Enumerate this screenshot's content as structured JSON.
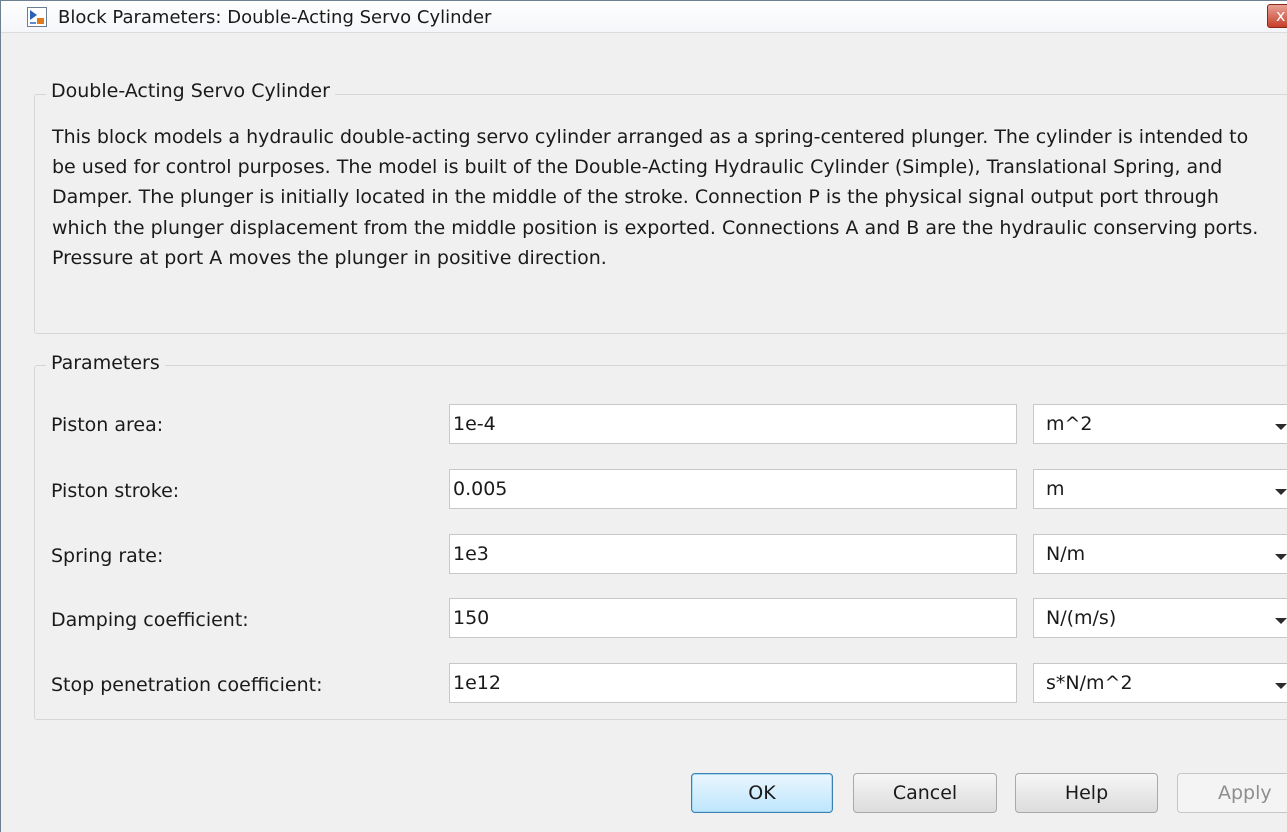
{
  "window": {
    "title": "Block Parameters: Double-Acting Servo Cylinder",
    "close_glyph": "x"
  },
  "description_group": {
    "title": "Double-Acting Servo Cylinder",
    "text": "This block models a hydraulic double-acting servo cylinder arranged as a spring-centered plunger. The cylinder is intended to be used for control purposes. The model is built of the Double-Acting Hydraulic Cylinder (Simple), Translational Spring, and Damper. The plunger is initially located in the middle of the stroke. Connection P is the physical signal output port through which the plunger displacement from the middle position is exported. Connections A and B are the hydraulic conserving ports. Pressure at port A moves the plunger in positive direction."
  },
  "parameters_group": {
    "title": "Parameters",
    "rows": [
      {
        "label": "Piston area:",
        "value": "1e-4",
        "unit": "m^2"
      },
      {
        "label": "Piston stroke:",
        "value": "0.005",
        "unit": "m"
      },
      {
        "label": "Spring rate:",
        "value": "1e3",
        "unit": "N/m"
      },
      {
        "label": "Damping coefficient:",
        "value": "150",
        "unit": "N/(m/s)"
      },
      {
        "label": "Stop penetration coefficient:",
        "value": "1e12",
        "unit": "s*N/m^2"
      }
    ]
  },
  "buttons": {
    "ok": "OK",
    "cancel": "Cancel",
    "help": "Help",
    "apply": "Apply"
  },
  "colors": {
    "window_bg": "#f0f0f0",
    "primary_button": "#bee6fd",
    "close_button": "#c7402c"
  },
  "icons": {
    "app": "simulink-block-icon",
    "dropdown": "chevron-down-icon"
  }
}
